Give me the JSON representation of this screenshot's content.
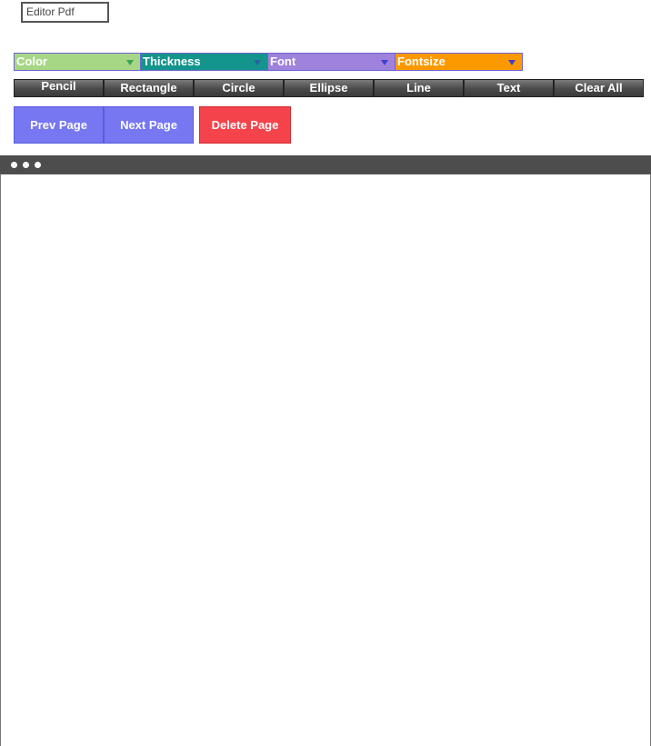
{
  "app": {
    "title": "Editor Pdf"
  },
  "selects": [
    {
      "label": "Color",
      "bg": "#a6d785",
      "caret": "#3aa35a"
    },
    {
      "label": "Thickness",
      "bg": "#13958d",
      "caret": "#2b5fa8"
    },
    {
      "label": "Font",
      "bg": "#9e82db",
      "caret": "#3d3fd0"
    },
    {
      "label": "Fontsize",
      "bg": "#fd9900",
      "caret": "#3f3fcf"
    }
  ],
  "tools": {
    "pencil": "Pencil",
    "rectangle": "Rectangle",
    "circle": "Circle",
    "ellipse": "Ellipse",
    "line": "Line",
    "text": "Text",
    "clear_all": "Clear All"
  },
  "pages": {
    "prev": "Prev Page",
    "next": "Next Page",
    "delete": "Delete Page"
  },
  "window": {
    "controls": [
      "window-dot-icon",
      "window-dot-icon",
      "window-dot-icon"
    ]
  }
}
